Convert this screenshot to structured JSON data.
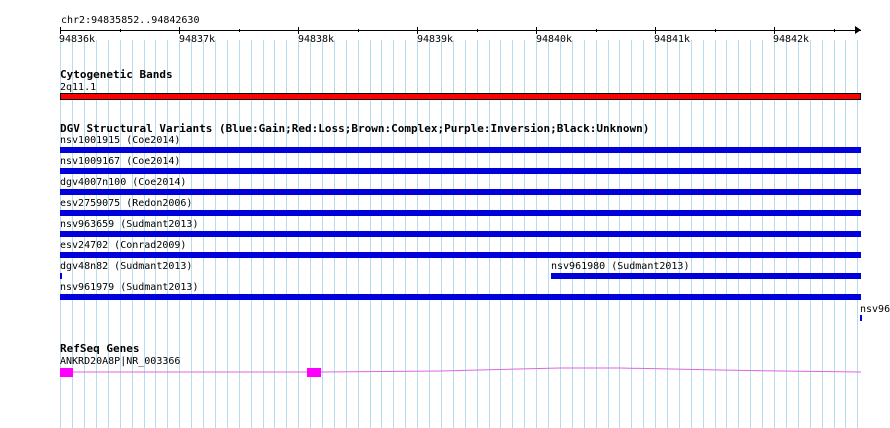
{
  "ruler": {
    "location": "chr2:94835852..94842630",
    "ticks": [
      "94836k",
      "94837k",
      "94838k",
      "94839k",
      "94840k",
      "94841k",
      "94842k"
    ]
  },
  "cytoband": {
    "title": "Cytogenetic Bands",
    "band_label": "2q11.1",
    "color": "#ff0000"
  },
  "dgv": {
    "title": "DGV Structural Variants (Blue:Gain;Red:Loss;Brown:Complex;Purple:Inversion;Black:Unknown)",
    "color": "#0000dd",
    "features": [
      {
        "label": "nsv1001915 (Coe2014)"
      },
      {
        "label": "nsv1009167 (Coe2014)"
      },
      {
        "label": "dgv4007n100 (Coe2014)"
      },
      {
        "label": "esv2759075 (Redon2006)"
      },
      {
        "label": "nsv963659 (Sudmant2013)"
      },
      {
        "label": "esv24702 (Conrad2009)"
      },
      {
        "label": "dgv48n82 (Sudmant2013)"
      },
      {
        "label": "nsv961980 (Sudmant2013)"
      },
      {
        "label": "nsv961979 (Sudmant2013)"
      },
      {
        "label": "nsv96"
      }
    ]
  },
  "refseq": {
    "title": "RefSeq Genes",
    "gene_label": "ANKRD20A8P|NR_003366",
    "exon_color": "#ff00ff",
    "intron_color": "#dd66dd"
  }
}
